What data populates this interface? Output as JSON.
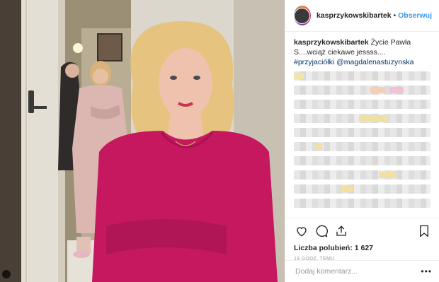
{
  "post": {
    "username": "kasprzykowskibartek",
    "follow_label": "Obserwuj",
    "separator": "•",
    "caption_user": "kasprzykowskibartek",
    "caption_text": " Życie Pawła S....wciąż ciekawe jessss....",
    "caption_tags": "#przyjaciółki @magdalenastuzynska",
    "likes_label": "Liczba polubień: 1 627",
    "time_ago": "19 GODZ. TEMU",
    "comment_placeholder": "Dodaj komentarz...",
    "more_label": "•••"
  },
  "colors": {
    "accent": "#3897f0",
    "tag": "#003569",
    "dress": "#c5185f",
    "robe": "#dcb7b1"
  },
  "icons": [
    "heart-icon",
    "comment-icon",
    "share-icon",
    "bookmark-icon",
    "more-icon"
  ]
}
